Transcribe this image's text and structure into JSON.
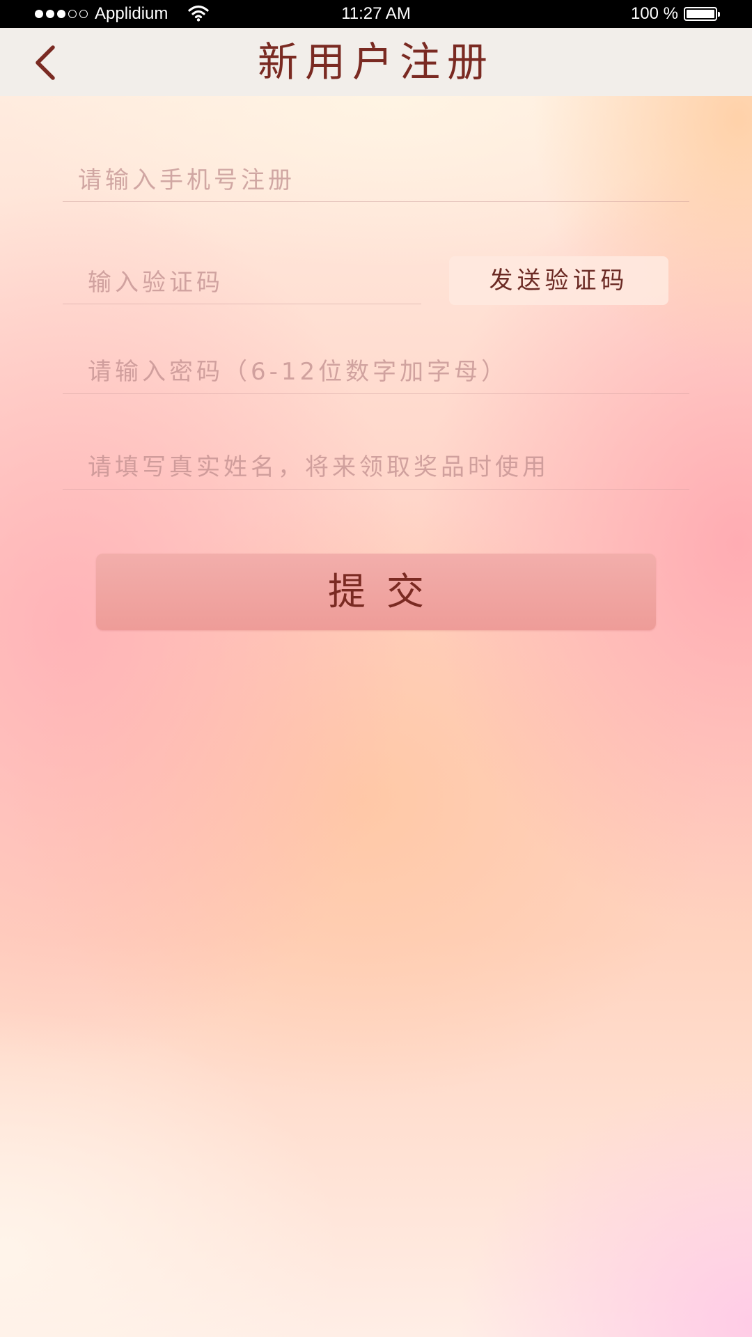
{
  "status_bar": {
    "carrier": "Applidium",
    "signal_icon": "signal-dots-icon",
    "wifi_icon": "wifi-icon",
    "time": "11:27 AM",
    "battery_text": "100 %",
    "battery_icon": "battery-icon"
  },
  "nav": {
    "back_icon": "chevron-left-icon",
    "title": "新用户注册"
  },
  "form": {
    "phone": {
      "value": "",
      "placeholder": "请输入手机号注册"
    },
    "code": {
      "value": "",
      "placeholder": "输入验证码"
    },
    "send_code_label": "发送验证码",
    "password": {
      "value": "",
      "placeholder": "请输入密码（6-12位数字加字母）"
    },
    "real_name": {
      "value": "",
      "placeholder": "请填写真实姓名，将来领取奖品时使用"
    },
    "submit_label": "提交"
  },
  "colors": {
    "title": "#7a2a22",
    "nav_background": "#f2eeea",
    "submit_button": "#ef a4a0"
  }
}
